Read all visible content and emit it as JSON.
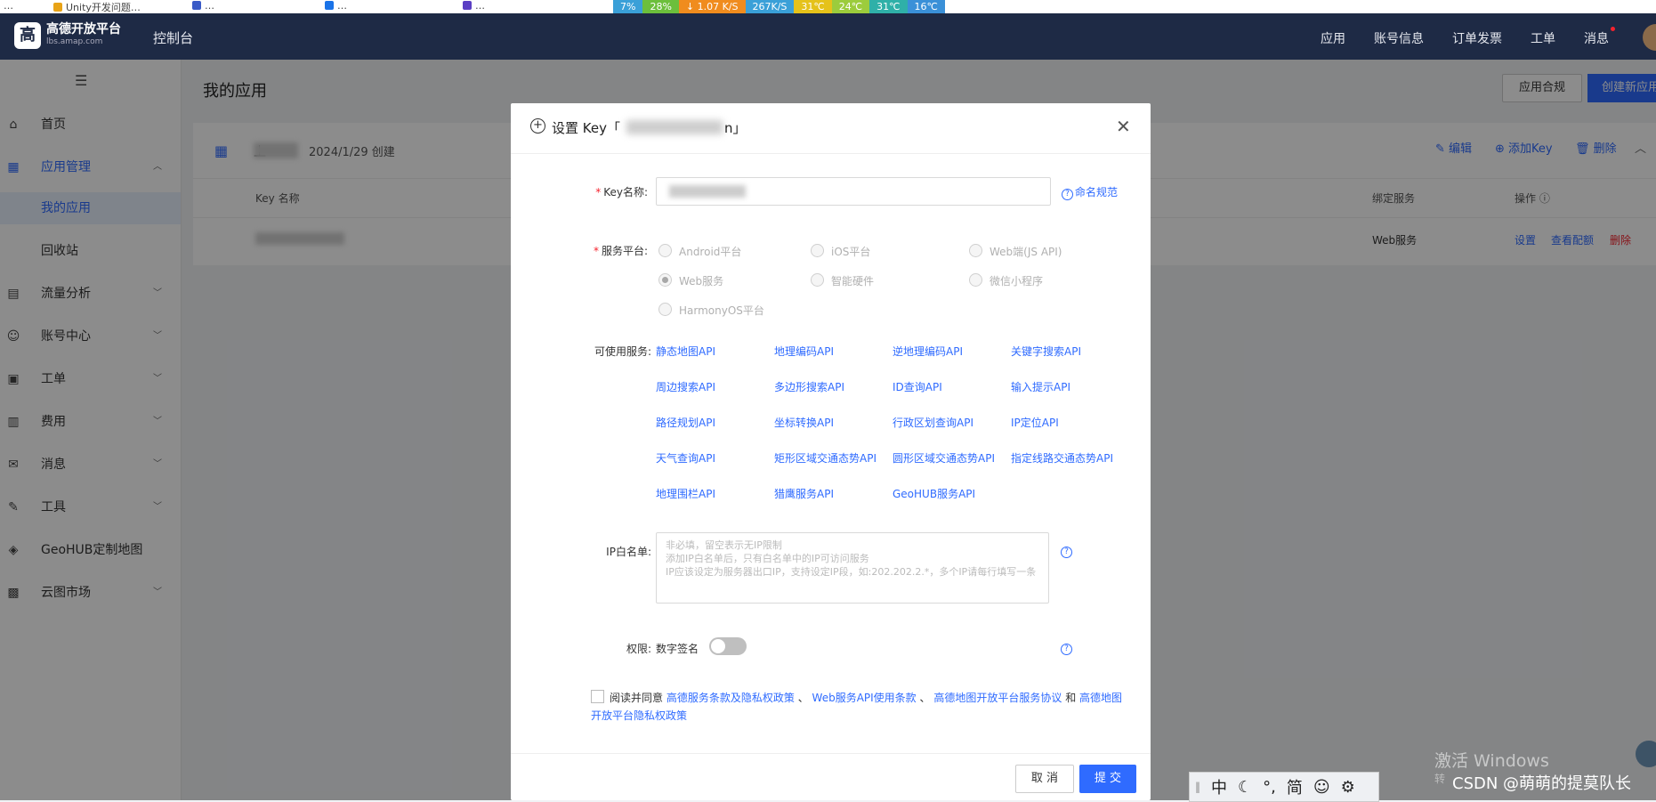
{
  "browser": {
    "bookmarks": [
      "…",
      "Unity开发问题… ",
      "…",
      "…",
      "…"
    ],
    "netbar": [
      "7%",
      "28%",
      "↓ 1.07 K/S",
      "267K/S",
      "31℃",
      "24℃",
      "31℃",
      "16℃"
    ]
  },
  "topnav": {
    "logo_mark": "高",
    "logo_title": "高德开放平台",
    "logo_sub": "lbs.amap.com",
    "console": "控制台",
    "links": [
      "应用",
      "账号信息",
      "订单发票",
      "工单",
      "消息"
    ]
  },
  "sidebar": {
    "menu_icon": "☰",
    "items": [
      {
        "icon": "⌂",
        "label": "首页",
        "chevron": ""
      },
      {
        "icon": "▦",
        "label": "应用管理",
        "chevron": "︿"
      },
      {
        "icon": "",
        "label": "我的应用",
        "chevron": ""
      },
      {
        "icon": "",
        "label": "回收站",
        "chevron": ""
      },
      {
        "icon": "▤",
        "label": "流量分析",
        "chevron": "﹀"
      },
      {
        "icon": "☺",
        "label": "账号中心",
        "chevron": "﹀"
      },
      {
        "icon": "▣",
        "label": "工单",
        "chevron": "﹀"
      },
      {
        "icon": "▥",
        "label": "费用",
        "chevron": "﹀"
      },
      {
        "icon": "✉",
        "label": "消息",
        "chevron": "﹀"
      },
      {
        "icon": "✎",
        "label": "工具",
        "chevron": "﹀"
      },
      {
        "icon": "◈",
        "label": "GeoHUB定制地图",
        "chevron": ""
      },
      {
        "icon": "▩",
        "label": "云图市场",
        "chevron": "﹀"
      }
    ]
  },
  "main": {
    "title": "我的应用",
    "compliance_button": "应用合规",
    "create_button": "创建新应用",
    "app": {
      "name_prefix": "上",
      "date": "2024/1/29 创建",
      "actions": [
        "✎ 编辑",
        "⊕ 添加Key",
        "🗑 删除",
        "︿"
      ]
    },
    "table": {
      "headers": [
        "Key 名称",
        "绑定服务",
        "操作 ⓘ"
      ],
      "row": {
        "service": "Web服务",
        "ops": [
          "设置",
          "查看配额",
          "删除"
        ]
      }
    }
  },
  "modal": {
    "title_prefix": "设置 Key「",
    "title_suffix": "n」",
    "close": "✕",
    "key_label": "Key名称:",
    "naming_rule": "命名规范",
    "platform_label": "服务平台:",
    "platforms": [
      {
        "label": "Android平台",
        "checked": false
      },
      {
        "label": "iOS平台",
        "checked": false
      },
      {
        "label": "Web端(JS API)",
        "checked": false
      },
      {
        "label": "Web服务",
        "checked": true
      },
      {
        "label": "智能硬件",
        "checked": false
      },
      {
        "label": "微信小程序",
        "checked": false
      },
      {
        "label": "HarmonyOS平台",
        "checked": false
      }
    ],
    "services_label": "可使用服务:",
    "services": [
      "静态地图API",
      "地理编码API",
      "逆地理编码API",
      "关键字搜索API",
      "周边搜索API",
      "多边形搜索API",
      "ID查询API",
      "输入提示API",
      "路径规划API",
      "坐标转换API",
      "行政区划查询API",
      "IP定位API",
      "天气查询API",
      "矩形区域交通态势API",
      "圆形区域交通态势API",
      "指定线路交通态势API",
      "地理围栏API",
      "猎鹰服务API",
      "GeoHUB服务API"
    ],
    "ip_label": "IP白名单:",
    "ip_placeholder": "非必填，留空表示无IP限制\n添加IP白名单后，只有白名单中的IP可访问服务\nIP应该设定为服务器出口IP，支持设定IP段，如:202.202.2.*，多个IP请每行填写一条",
    "perm_label": "权限:",
    "perm_value": "数字签名",
    "agree": {
      "prefix": "阅读并同意",
      "link1": "高德服务条款及隐私权政策",
      "sep1": "、",
      "link2": "Web服务API使用条款",
      "sep2": "、",
      "link3": "高德地图开放平台服务协议",
      "and": "和",
      "link4": "高德地图开放平台隐私权政策"
    },
    "cancel": "取 消",
    "submit": "提 交"
  },
  "ime": [
    "‖",
    "中",
    "☾",
    "°,",
    "简",
    "☺",
    "⚙"
  ],
  "watermark": {
    "windows": "激活 Windows",
    "windows_sub": "转",
    "csdn": "CSDN @萌萌的提莫队长"
  },
  "colors": {
    "accent": "#2f6bff",
    "nav_bg": "#1e2a45",
    "danger": "#f5222d"
  }
}
